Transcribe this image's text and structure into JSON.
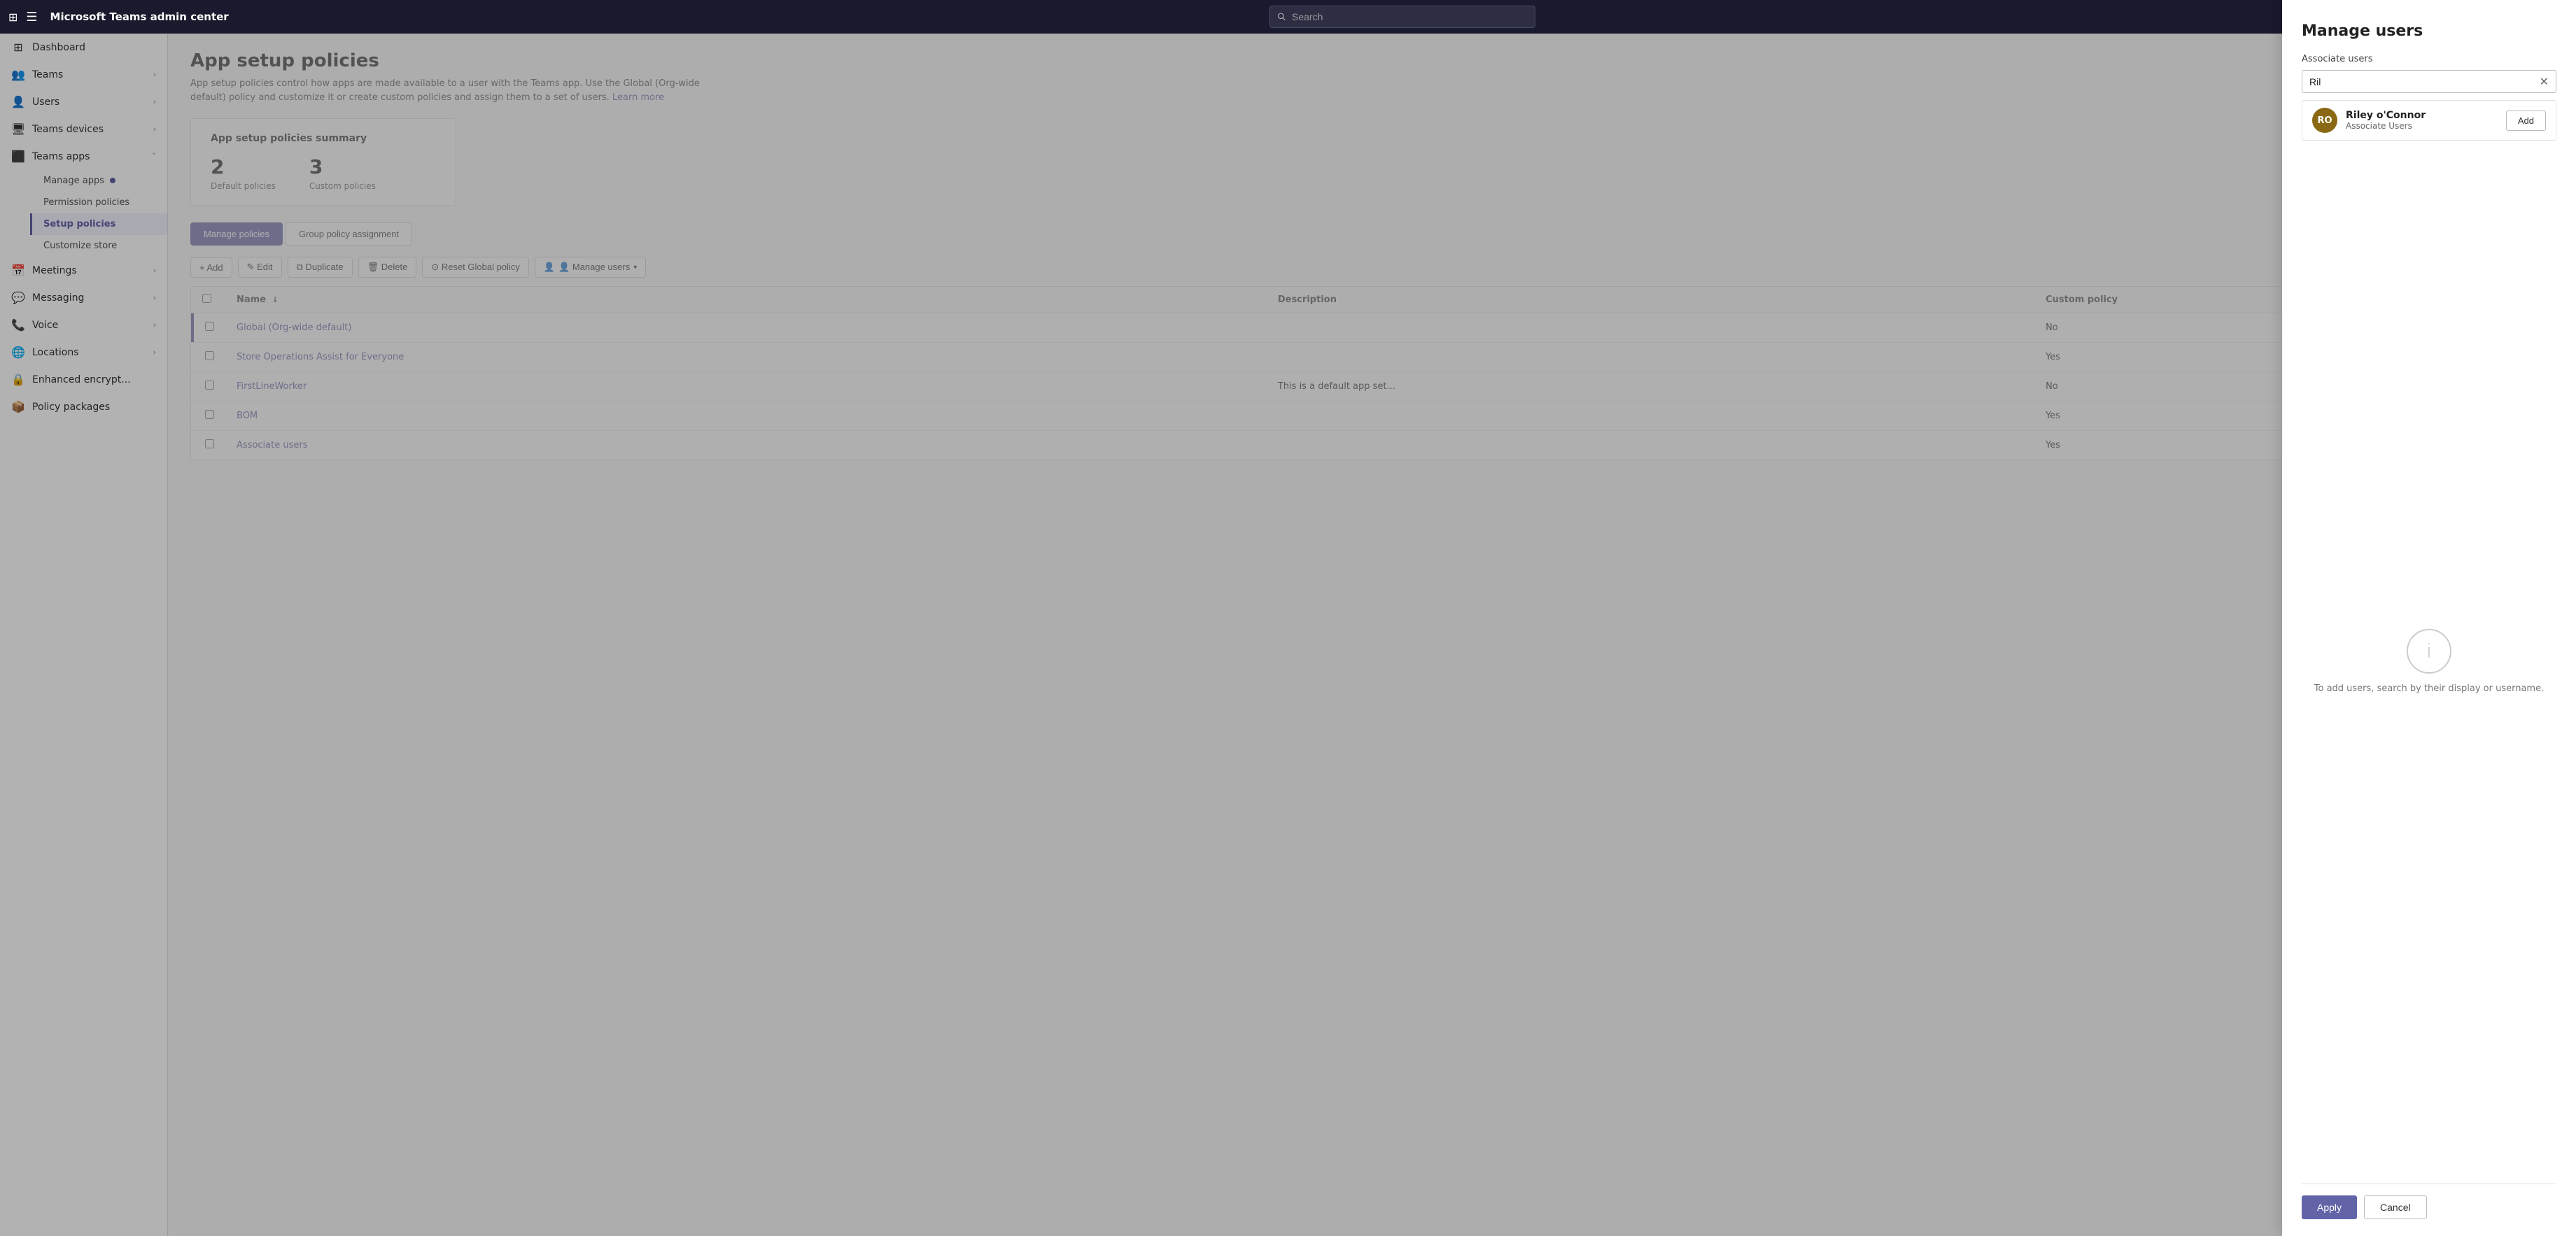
{
  "topbar": {
    "app_icon": "⊞",
    "title": "Microsoft Teams admin center",
    "search_placeholder": "Search"
  },
  "sidebar": {
    "hamburger": "☰",
    "items": [
      {
        "id": "dashboard",
        "label": "Dashboard",
        "icon": "⊞",
        "has_children": false
      },
      {
        "id": "teams",
        "label": "Teams",
        "icon": "👥",
        "has_children": true,
        "expanded": false
      },
      {
        "id": "users",
        "label": "Users",
        "icon": "👤",
        "has_children": true,
        "expanded": false
      },
      {
        "id": "teams-devices",
        "label": "Teams devices",
        "icon": "🖥",
        "has_children": true,
        "expanded": false
      },
      {
        "id": "teams-apps",
        "label": "Teams apps",
        "icon": "⬛",
        "has_children": true,
        "expanded": true
      },
      {
        "id": "meetings",
        "label": "Meetings",
        "icon": "📅",
        "has_children": true,
        "expanded": false
      },
      {
        "id": "messaging",
        "label": "Messaging",
        "icon": "💬",
        "has_children": true,
        "expanded": false
      },
      {
        "id": "voice",
        "label": "Voice",
        "icon": "📞",
        "has_children": true,
        "expanded": false
      },
      {
        "id": "locations",
        "label": "Locations",
        "icon": "🌐",
        "has_children": true,
        "expanded": false
      },
      {
        "id": "enhanced-encrypt",
        "label": "Enhanced encrypt...",
        "icon": "🔒",
        "has_children": false
      },
      {
        "id": "policy-packages",
        "label": "Policy packages",
        "icon": "📦",
        "has_children": false
      }
    ],
    "teams_apps_sub": [
      {
        "id": "manage-apps",
        "label": "Manage apps",
        "has_badge": true
      },
      {
        "id": "permission-policies",
        "label": "Permission policies",
        "has_badge": false
      },
      {
        "id": "setup-policies",
        "label": "Setup policies",
        "has_badge": false,
        "active": true
      },
      {
        "id": "customize-store",
        "label": "Customize store",
        "has_badge": false
      }
    ]
  },
  "main": {
    "page_title": "App setup policies",
    "page_description": "App setup policies control how apps are made available to a user with the Teams app. Use the Global (Org-wide default) policy and customize it or create custom policies and assign them to a set of users.",
    "learn_more": "Learn more",
    "summary_card": {
      "title": "App setup policies summary",
      "default_policies_count": "2",
      "default_policies_label": "Default policies",
      "custom_policies_count": "3",
      "custom_policies_label": "Custom policies"
    },
    "tabs": [
      {
        "id": "manage-policies",
        "label": "Manage policies",
        "active": true
      },
      {
        "id": "group-policy",
        "label": "Group policy assignment",
        "active": false
      }
    ],
    "toolbar": {
      "add_label": "+ Add",
      "edit_label": "✎ Edit",
      "duplicate_label": "⧉ Duplicate",
      "delete_label": "🗑 Delete",
      "reset_label": "⊙ Reset Global policy",
      "manage_users_label": "👤 Manage users",
      "manage_users_chevron": "▾"
    },
    "table": {
      "columns": [
        {
          "id": "name",
          "label": "Name",
          "sort": "asc"
        },
        {
          "id": "description",
          "label": "Description"
        },
        {
          "id": "custom_policy",
          "label": "Custom policy"
        }
      ],
      "rows": [
        {
          "id": 1,
          "name": "Global (Org-wide default)",
          "description": "",
          "custom_policy": "No",
          "highlighted": true
        },
        {
          "id": 2,
          "name": "Store Operations Assist for Everyone",
          "description": "",
          "custom_policy": "Yes",
          "highlighted": false
        },
        {
          "id": 3,
          "name": "FirstLineWorker",
          "description": "This is a default app set...",
          "custom_policy": "No",
          "highlighted": false
        },
        {
          "id": 4,
          "name": "BOM",
          "description": "",
          "custom_policy": "Yes",
          "highlighted": false
        },
        {
          "id": 5,
          "name": "Associate users",
          "description": "",
          "custom_policy": "Yes",
          "highlighted": false
        }
      ]
    }
  },
  "side_panel": {
    "title": "Manage users",
    "associate_users_label": "Associate users",
    "search_value": "Ril",
    "search_placeholder": "",
    "clear_btn": "✕",
    "user_result": {
      "initials": "RO",
      "name": "Riley o'Connor",
      "role": "Associate Users",
      "add_label": "Add"
    },
    "info_icon": "i",
    "info_text": "To add users, search by their display or username.",
    "apply_label": "Apply",
    "cancel_label": "Cancel"
  }
}
